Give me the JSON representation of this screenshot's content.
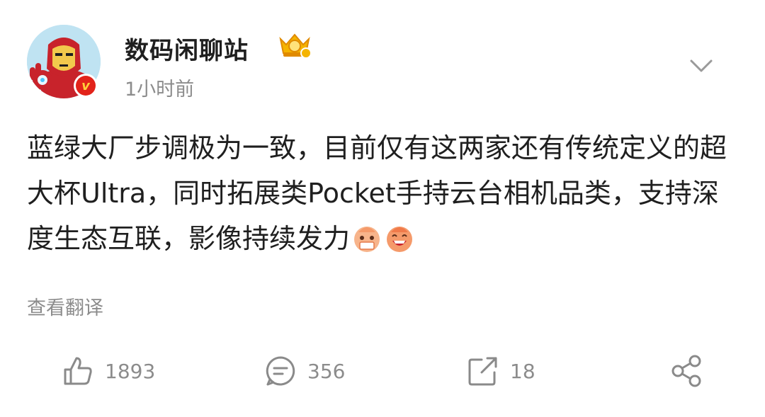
{
  "post": {
    "username": "数码闲聊站",
    "time": "1小时前",
    "badge_letter": "v",
    "body_text": "蓝绿大厂步调极为一致，目前仅有这两家还有传统定义的超大杯Ultra，同时拓展类Pocket手持云台相机品类，支持深度生态互联，影像持续发力",
    "translate_label": "查看翻译"
  },
  "actions": {
    "like_count": "1893",
    "comment_count": "356",
    "repost_count": "18"
  },
  "icons": {
    "avatar": "iron-man-avatar",
    "badge": "verified-v-icon",
    "crown": "crown-level-icon",
    "more": "chevron-down-icon",
    "emoji": "laughing-emoji-icon",
    "like": "thumbs-up-icon",
    "comment": "comment-icon",
    "repost": "repost-icon",
    "share": "share-icon"
  },
  "colors": {
    "text": "#1f1f1f",
    "muted": "#8c8c8c",
    "badge_red": "#e2231a",
    "badge_yellow": "#ffcf3a",
    "icon_gray": "#8a8a8a"
  }
}
